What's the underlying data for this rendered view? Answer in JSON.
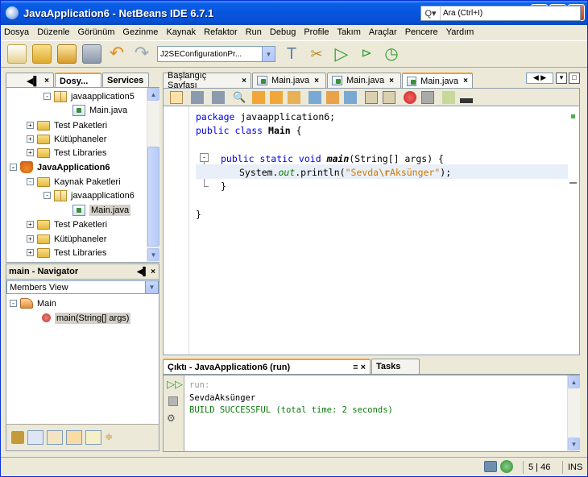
{
  "window": {
    "title": "JavaApplication6 - NetBeans IDE 6.7.1"
  },
  "menu": [
    "Dosya",
    "Düzenle",
    "Görünüm",
    "Gezinme",
    "Kaynak",
    "Refaktor",
    "Run",
    "Debug",
    "Profile",
    "Takım",
    "Araçlar",
    "Pencere",
    "Yardım"
  ],
  "toolbar": {
    "config": "J2SEConfigurationPr...",
    "search_placeholder": "Ara (Ctrl+I)"
  },
  "projects": {
    "tabs": [
      "Dosy...",
      "Services"
    ],
    "tree": [
      {
        "label": "javaapplication5",
        "type": "package",
        "expander": "-"
      },
      {
        "label": "Main.java",
        "type": "javafile"
      },
      {
        "label": "Test Paketleri",
        "type": "folder",
        "expander": "+"
      },
      {
        "label": "Kütüphaneler",
        "type": "folder",
        "expander": "+"
      },
      {
        "label": "Test Libraries",
        "type": "folder",
        "expander": "+"
      },
      {
        "label": "JavaApplication6",
        "type": "project",
        "expander": "-"
      },
      {
        "label": "Kaynak Paketleri",
        "type": "folder",
        "expander": "-"
      },
      {
        "label": "javaapplication6",
        "type": "package",
        "expander": "-"
      },
      {
        "label": "Main.java",
        "type": "javafile"
      },
      {
        "label": "Test Paketleri",
        "type": "folder",
        "expander": "+"
      },
      {
        "label": "Kütüphaneler",
        "type": "folder",
        "expander": "+"
      },
      {
        "label": "Test Libraries",
        "type": "folder",
        "expander": "+"
      }
    ]
  },
  "navigator": {
    "title": "main - Navigator",
    "view": "Members View",
    "root": "Main",
    "member": "main(String[] args)"
  },
  "editor": {
    "tabs": [
      "Başlangıç Sayfası",
      "Main.java",
      "Main.java",
      "Main.java"
    ],
    "code": {
      "l1_kw": "package",
      "l1_rest": " javaapplication6;",
      "l2_kw": "public class",
      "l2_name": "Main",
      "l2_rest": " {",
      "l3_kw": "public static void",
      "l3_name": "main",
      "l3_rest": "(String[] args) {",
      "l4_pre": "System.",
      "l4_out": "out",
      "l4_mid": ".println(",
      "l4_str1": "\"Sevda",
      "l4_esc": "\\r",
      "l4_str2": "Aksünger\"",
      "l4_end": ");",
      "l5": "}",
      "l6": "}"
    }
  },
  "output": {
    "tab": "Çıktı - JavaApplication6 (run)",
    "tab2": "Tasks",
    "lines": [
      "run:",
      "SevdaAksünger",
      "BUILD SUCCESSFUL (total time: 2 seconds)"
    ]
  },
  "status": {
    "position": "5 | 46",
    "mode": "INS"
  }
}
